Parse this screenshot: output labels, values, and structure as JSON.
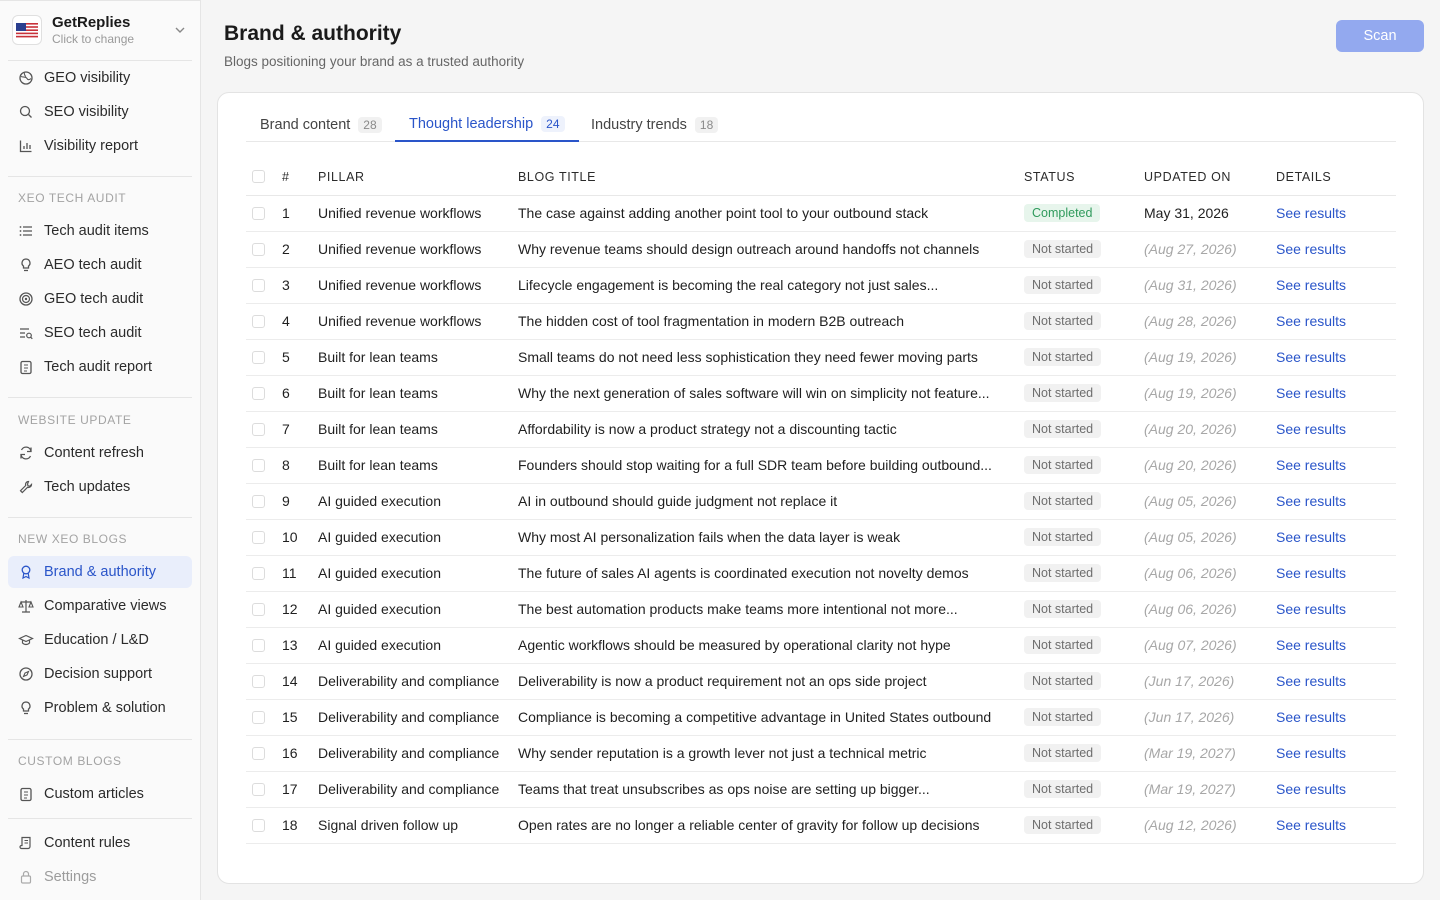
{
  "workspace": {
    "name": "GetReplies",
    "subtitle": "Click to change"
  },
  "sidebar": {
    "top_items": [
      {
        "label": "GEO visibility",
        "icon": "globe-icon"
      },
      {
        "label": "SEO visibility",
        "icon": "search-icon"
      },
      {
        "label": "Visibility report",
        "icon": "bar-chart-icon"
      }
    ],
    "sections": [
      {
        "label": "XEO TECH AUDIT",
        "items": [
          {
            "label": "Tech audit items",
            "icon": "list-icon"
          },
          {
            "label": "AEO tech audit",
            "icon": "lightbulb-icon"
          },
          {
            "label": "GEO tech audit",
            "icon": "target-icon"
          },
          {
            "label": "SEO tech audit",
            "icon": "lines-search-icon"
          },
          {
            "label": "Tech audit report",
            "icon": "clipboard-icon"
          }
        ]
      },
      {
        "label": "WEBSITE UPDATE",
        "items": [
          {
            "label": "Content refresh",
            "icon": "refresh-icon"
          },
          {
            "label": "Tech updates",
            "icon": "wrench-icon"
          }
        ]
      },
      {
        "label": "NEW XEO BLOGS",
        "items": [
          {
            "label": "Brand & authority",
            "icon": "award-icon",
            "active": true
          },
          {
            "label": "Comparative views",
            "icon": "scale-icon"
          },
          {
            "label": "Education / L&D",
            "icon": "graduation-cap-icon"
          },
          {
            "label": "Decision support",
            "icon": "compass-icon"
          },
          {
            "label": "Problem & solution",
            "icon": "lightbulb-icon"
          }
        ]
      },
      {
        "label": "CUSTOM BLOGS",
        "items": [
          {
            "label": "Custom articles",
            "icon": "clipboard-icon"
          }
        ]
      }
    ],
    "bottom_items": [
      {
        "label": "Content rules",
        "icon": "scroll-icon"
      },
      {
        "label": "Settings",
        "icon": "lock-icon",
        "muted": true
      }
    ]
  },
  "header": {
    "title": "Brand & authority",
    "subtitle": "Blogs positioning your brand as a trusted authority",
    "scan_label": "Scan"
  },
  "tabs": [
    {
      "label": "Brand content",
      "count": "28"
    },
    {
      "label": "Thought leadership",
      "count": "24",
      "active": true
    },
    {
      "label": "Industry trends",
      "count": "18"
    }
  ],
  "table": {
    "columns": [
      "#",
      "PILLAR",
      "BLOG TITLE",
      "STATUS",
      "UPDATED ON",
      "DETAILS"
    ],
    "rows": [
      {
        "num": "1",
        "pillar": "Unified revenue workflows",
        "title": "The case against adding another point tool to your outbound stack",
        "status": "Completed",
        "updated": "May 31, 2026",
        "details": "See results"
      },
      {
        "num": "2",
        "pillar": "Unified revenue workflows",
        "title": "Why revenue teams should design outreach around handoffs not channels",
        "status": "Not started",
        "updated": "(Aug 27, 2026)",
        "details": "See results"
      },
      {
        "num": "3",
        "pillar": "Unified revenue workflows",
        "title": "Lifecycle engagement is becoming the real category not just sales...",
        "status": "Not started",
        "updated": "(Aug 31, 2026)",
        "details": "See results"
      },
      {
        "num": "4",
        "pillar": "Unified revenue workflows",
        "title": "The hidden cost of tool fragmentation in modern B2B outreach",
        "status": "Not started",
        "updated": "(Aug 28, 2026)",
        "details": "See results"
      },
      {
        "num": "5",
        "pillar": "Built for lean teams",
        "title": "Small teams do not need less sophistication they need fewer moving parts",
        "status": "Not started",
        "updated": "(Aug 19, 2026)",
        "details": "See results"
      },
      {
        "num": "6",
        "pillar": "Built for lean teams",
        "title": "Why the next generation of sales software will win on simplicity not feature...",
        "status": "Not started",
        "updated": "(Aug 19, 2026)",
        "details": "See results"
      },
      {
        "num": "7",
        "pillar": "Built for lean teams",
        "title": "Affordability is now a product strategy not a discounting tactic",
        "status": "Not started",
        "updated": "(Aug 20, 2026)",
        "details": "See results"
      },
      {
        "num": "8",
        "pillar": "Built for lean teams",
        "title": "Founders should stop waiting for a full SDR team before building outbound...",
        "status": "Not started",
        "updated": "(Aug 20, 2026)",
        "details": "See results"
      },
      {
        "num": "9",
        "pillar": "AI guided execution",
        "title": "AI in outbound should guide judgment not replace it",
        "status": "Not started",
        "updated": "(Aug 05, 2026)",
        "details": "See results"
      },
      {
        "num": "10",
        "pillar": "AI guided execution",
        "title": "Why most AI personalization fails when the data layer is weak",
        "status": "Not started",
        "updated": "(Aug 05, 2026)",
        "details": "See results"
      },
      {
        "num": "11",
        "pillar": "AI guided execution",
        "title": "The future of sales AI agents is coordinated execution not novelty demos",
        "status": "Not started",
        "updated": "(Aug 06, 2026)",
        "details": "See results"
      },
      {
        "num": "12",
        "pillar": "AI guided execution",
        "title": "The best automation products make teams more intentional not more...",
        "status": "Not started",
        "updated": "(Aug 06, 2026)",
        "details": "See results"
      },
      {
        "num": "13",
        "pillar": "AI guided execution",
        "title": "Agentic workflows should be measured by operational clarity not hype",
        "status": "Not started",
        "updated": "(Aug 07, 2026)",
        "details": "See results"
      },
      {
        "num": "14",
        "pillar": "Deliverability and compliance",
        "title": "Deliverability is now a product requirement not an ops side project",
        "status": "Not started",
        "updated": "(Jun 17, 2026)",
        "details": "See results"
      },
      {
        "num": "15",
        "pillar": "Deliverability and compliance",
        "title": "Compliance is becoming a competitive advantage in United States outbound",
        "status": "Not started",
        "updated": "(Jun 17, 2026)",
        "details": "See results"
      },
      {
        "num": "16",
        "pillar": "Deliverability and compliance",
        "title": "Why sender reputation is a growth lever not just a technical metric",
        "status": "Not started",
        "updated": "(Mar 19, 2027)",
        "details": "See results"
      },
      {
        "num": "17",
        "pillar": "Deliverability and compliance",
        "title": "Teams that treat unsubscribes as ops noise are setting up bigger...",
        "status": "Not started",
        "updated": "(Mar 19, 2027)",
        "details": "See results"
      },
      {
        "num": "18",
        "pillar": "Signal driven follow up",
        "title": "Open rates are no longer a reliable center of gravity for follow up decisions",
        "status": "Not started",
        "updated": "(Aug 12, 2026)",
        "details": "See results"
      }
    ]
  }
}
